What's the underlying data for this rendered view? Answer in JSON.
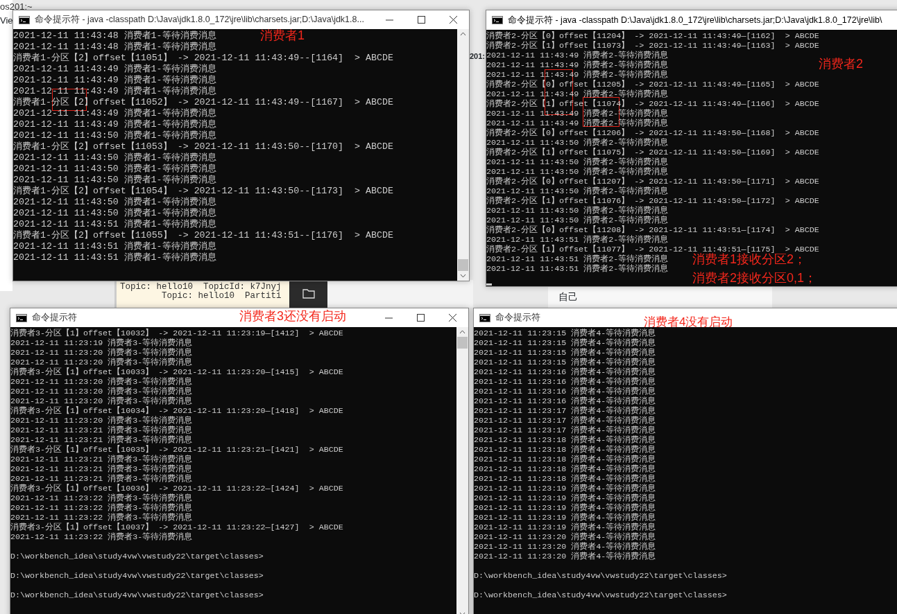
{
  "background": {
    "terminal_title": "os201:~",
    "menu_item": "Vie",
    "side_fragment": "201:",
    "terminal_lines": [
      "Topic: hello10  TopicId: k7Jnyj",
      "        Topic: hello10  Partiti"
    ],
    "chat_name": "自己"
  },
  "windows": [
    {
      "title": "命令提示符 - java  -classpath D:\\Java\\jdk1.8.0_172\\jre\\lib\\charsets.jar;D:\\Java\\jdk1.8...",
      "show_controls": true,
      "show_cursor": false,
      "lines": [
        "2021-12-11 11:43:48 消费者1-等待消费消息",
        "2021-12-11 11:43:48 消费者1-等待消费消息",
        "消费者1-分区【2】offset【11051】 -> 2021-12-11 11:43:49--[1164]  > ABCDE",
        "2021-12-11 11:43:49 消费者1-等待消费消息",
        "2021-12-11 11:43:49 消费者1-等待消费消息",
        "2021-12-11 11:43:49 消费者1-等待消费消息",
        "消费者1-分区【2】offset【11052】 -> 2021-12-11 11:43:49--[1167]  > ABCDE",
        "2021-12-11 11:43:49 消费者1-等待消费消息",
        "2021-12-11 11:43:49 消费者1-等待消费消息",
        "2021-12-11 11:43:50 消费者1-等待消费消息",
        "消费者1-分区【2】offset【11053】 -> 2021-12-11 11:43:50--[1170]  > ABCDE",
        "2021-12-11 11:43:50 消费者1-等待消费消息",
        "2021-12-11 11:43:50 消费者1-等待消费消息",
        "2021-12-11 11:43:50 消费者1-等待消费消息",
        "消费者1-分区【2】offset【11054】 -> 2021-12-11 11:43:50--[1173]  > ABCDE",
        "2021-12-11 11:43:50 消费者1-等待消费消息",
        "2021-12-11 11:43:50 消费者1-等待消费消息",
        "2021-12-11 11:43:51 消费者1-等待消费消息",
        "消费者1-分区【2】offset【11055】 -> 2021-12-11 11:43:51--[1176]  > ABCDE",
        "2021-12-11 11:43:51 消费者1-等待消费消息",
        "2021-12-11 11:43:51 消费者1-等待消费消息"
      ]
    },
    {
      "title": "命令提示符 - java  -classpath D:\\Java\\jdk1.8.0_172\\jre\\lib\\charsets.jar;D:\\Java\\jdk1.8.0_172\\jre\\lib\\",
      "show_controls": false,
      "show_cursor": true,
      "lines": [
        "消费者2-分区【0】offset【11204】 -> 2021-12-11 11:43:49—[1162]  > ABCDE",
        "消费者2-分区【1】offset【11073】 -> 2021-12-11 11:43:49—[1163]  > ABCDE",
        "2021-12-11 11:43:49 消费者2-等待消费消息",
        "2021-12-11 11:43:49 消费者2-等待消费消息",
        "2021-12-11 11:43:49 消费者2-等待消费消息",
        "消费者2-分区【0】offset【11205】 -> 2021-12-11 11:43:49—[1165]  > ABCDE",
        "2021-12-11 11:43:49 消费者2-等待消费消息",
        "消费者2-分区【1】offset【11074】 -> 2021-12-11 11:43:49—[1166]  > ABCDE",
        "2021-12-11 11:43:49 消费者2-等待消费消息",
        "2021-12-11 11:43:49 消费者2-等待消费消息",
        "消费者2-分区【0】offset【11206】 -> 2021-12-11 11:43:50—[1168]  > ABCDE",
        "2021-12-11 11:43:50 消费者2-等待消费消息",
        "消费者2-分区【1】offset【11075】 -> 2021-12-11 11:43:50—[1169]  > ABCDE",
        "2021-12-11 11:43:50 消费者2-等待消费消息",
        "2021-12-11 11:43:50 消费者2-等待消费消息",
        "消费者2-分区【0】offset【11207】 -> 2021-12-11 11:43:50—[1171]  > ABCDE",
        "2021-12-11 11:43:50 消费者2-等待消费消息",
        "消费者2-分区【1】offset【11076】 -> 2021-12-11 11:43:50—[1172]  > ABCDE",
        "2021-12-11 11:43:50 消费者2-等待消费消息",
        "2021-12-11 11:43:50 消费者2-等待消费消息",
        "消费者2-分区【0】offset【11208】 -> 2021-12-11 11:43:51—[1174]  > ABCDE",
        "2021-12-11 11:43:51 消费者2-等待消费消息",
        "消费者2-分区【1】offset【11077】 -> 2021-12-11 11:43:51—[1175]  > ABCDE",
        "2021-12-11 11:43:51 消费者2-等待消费消息",
        "2021-12-11 11:43:51 消费者2-等待消费消息"
      ]
    },
    {
      "title": "命令提示符",
      "show_controls": true,
      "show_cursor": false,
      "lines": [
        "消费者3-分区【1】offset【10032】 -> 2021-12-11 11:23:19—[1412]  > ABCDE",
        "2021-12-11 11:23:19 消费者3-等待消费消息",
        "2021-12-11 11:23:20 消费者3-等待消费消息",
        "2021-12-11 11:23:20 消费者3-等待消费消息",
        "消费者3-分区【1】offset【10033】 -> 2021-12-11 11:23:20—[1415]  > ABCDE",
        "2021-12-11 11:23:20 消费者3-等待消费消息",
        "2021-12-11 11:23:20 消费者3-等待消费消息",
        "2021-12-11 11:23:20 消费者3-等待消费消息",
        "消费者3-分区【1】offset【10034】 -> 2021-12-11 11:23:20—[1418]  > ABCDE",
        "2021-12-11 11:23:20 消费者3-等待消费消息",
        "2021-12-11 11:23:21 消费者3-等待消费消息",
        "2021-12-11 11:23:21 消费者3-等待消费消息",
        "消费者3-分区【1】offset【10035】 -> 2021-12-11 11:23:21—[1421]  > ABCDE",
        "2021-12-11 11:23:21 消费者3-等待消费消息",
        "2021-12-11 11:23:21 消费者3-等待消费消息",
        "2021-12-11 11:23:21 消费者3-等待消费消息",
        "消费者3-分区【1】offset【10036】 -> 2021-12-11 11:23:22—[1424]  > ABCDE",
        "2021-12-11 11:23:22 消费者3-等待消费消息",
        "2021-12-11 11:23:22 消费者3-等待消费消息",
        "2021-12-11 11:23:22 消费者3-等待消费消息",
        "消费者3-分区【1】offset【10037】 -> 2021-12-11 11:23:22—[1427]  > ABCDE",
        "2021-12-11 11:23:22 消费者3-等待消费消息"
      ],
      "prompts": [
        "D:\\workbench_idea\\study4vw\\vwstudy22\\target\\classes>",
        "D:\\workbench_idea\\study4vw\\vwstudy22\\target\\classes>",
        "D:\\workbench_idea\\study4vw\\vwstudy22\\target\\classes>"
      ]
    },
    {
      "title": "命令提示符",
      "show_controls": false,
      "show_cursor": false,
      "lines": [
        "2021-12-11 11:23:15 消费者4-等待消费消息",
        "2021-12-11 11:23:15 消费者4-等待消费消息",
        "2021-12-11 11:23:15 消费者4-等待消费消息",
        "2021-12-11 11:23:15 消费者4-等待消费消息",
        "2021-12-11 11:23:16 消费者4-等待消费消息",
        "2021-12-11 11:23:16 消费者4-等待消费消息",
        "2021-12-11 11:23:16 消费者4-等待消费消息",
        "2021-12-11 11:23:16 消费者4-等待消费消息",
        "2021-12-11 11:23:17 消费者4-等待消费消息",
        "2021-12-11 11:23:17 消费者4-等待消费消息",
        "2021-12-11 11:23:17 消费者4-等待消费消息",
        "2021-12-11 11:23:18 消费者4-等待消费消息",
        "2021-12-11 11:23:18 消费者4-等待消费消息",
        "2021-12-11 11:23:18 消费者4-等待消费消息",
        "2021-12-11 11:23:18 消费者4-等待消费消息",
        "2021-12-11 11:23:18 消费者4-等待消费消息",
        "2021-12-11 11:23:19 消费者4-等待消费消息",
        "2021-12-11 11:23:19 消费者4-等待消费消息",
        "2021-12-11 11:23:19 消费者4-等待消费消息",
        "2021-12-11 11:23:19 消费者4-等待消费消息",
        "2021-12-11 11:23:19 消费者4-等待消费消息",
        "2021-12-11 11:23:20 消费者4-等待消费消息",
        "2021-12-11 11:23:20 消费者4-等待消费消息",
        "2021-12-11 11:23:20 消费者4-等待消费消息"
      ],
      "prompts": [
        "D:\\workbench_idea\\study4vw\\vwstudy22\\target\\classes>",
        "D:\\workbench_idea\\study4vw\\vwstudy22\\target\\classes>"
      ]
    }
  ],
  "annotations": [
    "消费者1",
    "消费者2",
    "消费者1接收分区2；",
    "消费者2接收分区0,1；",
    "消费者3还没有启动",
    "消费者4没有启动"
  ]
}
